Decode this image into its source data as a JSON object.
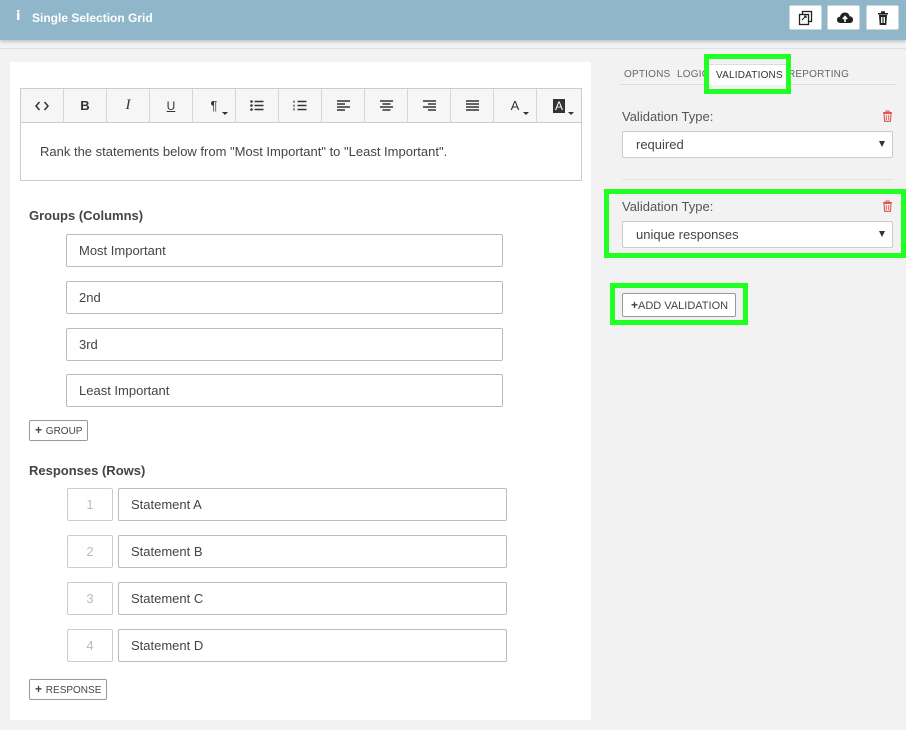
{
  "header": {
    "title": "Single Selection Grid",
    "info_icon": "info-icon",
    "buttons": [
      {
        "name": "copy-button",
        "icon": "copy-icon"
      },
      {
        "name": "upload-button",
        "icon": "cloud-upload-icon"
      },
      {
        "name": "delete-button",
        "icon": "trash-icon"
      }
    ]
  },
  "editor": {
    "toolbar": [
      {
        "name": "code-view-button",
        "glyph": "<>"
      },
      {
        "name": "bold-button",
        "glyph": "B"
      },
      {
        "name": "italic-button",
        "glyph": "I"
      },
      {
        "name": "underline-button",
        "glyph": "U"
      },
      {
        "name": "paragraph-button",
        "glyph": "¶"
      },
      {
        "name": "bullet-list-button",
        "glyph": "bullet-list-icon"
      },
      {
        "name": "numbered-list-button",
        "glyph": "numbered-list-icon"
      },
      {
        "name": "align-left-button",
        "glyph": "align-left-icon"
      },
      {
        "name": "align-center-button",
        "glyph": "align-center-icon"
      },
      {
        "name": "align-right-button",
        "glyph": "align-right-icon"
      },
      {
        "name": "justify-button",
        "glyph": "justify-icon"
      },
      {
        "name": "font-color-button",
        "glyph": "A"
      },
      {
        "name": "highlight-button",
        "glyph": "A"
      }
    ],
    "question_text": "Rank the statements below from \"Most Important\" to \"Least Important\".",
    "groups_label": "Groups (Columns)",
    "groups": [
      "Most Important",
      "2nd",
      "3rd",
      "Least Important"
    ],
    "add_group_label": "GROUP",
    "responses_label": "Responses (Rows)",
    "responses": [
      {
        "num": "1",
        "text": "Statement A"
      },
      {
        "num": "2",
        "text": "Statement B"
      },
      {
        "num": "3",
        "text": "Statement C"
      },
      {
        "num": "4",
        "text": "Statement D"
      }
    ],
    "add_response_label": "RESPONSE"
  },
  "panel": {
    "tabs": [
      "OPTIONS",
      "LOGIC",
      "VALIDATIONS",
      "REPORTING"
    ],
    "active_tab": "VALIDATIONS",
    "validations": [
      {
        "label": "Validation Type:",
        "value": "required"
      },
      {
        "label": "Validation Type:",
        "value": "unique responses"
      }
    ],
    "add_validation_label": "ADD VALIDATION"
  },
  "colors": {
    "header_bg": "#8fb7c9",
    "highlight": "#22ff22",
    "trash_red": "#e05555"
  }
}
